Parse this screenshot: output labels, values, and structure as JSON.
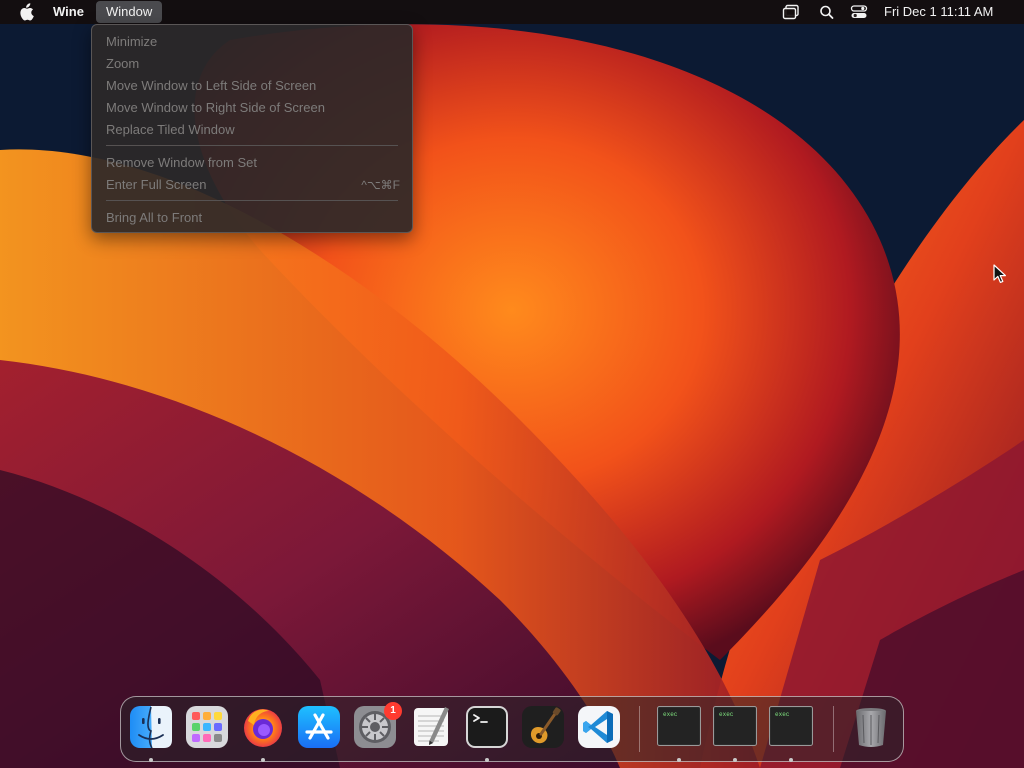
{
  "menubar": {
    "app_name": "Wine",
    "menu_window": "Window",
    "clock": "Fri Dec 1  11:11 AM",
    "status_icons": [
      "screen-mirroring-icon",
      "spotlight-search-icon",
      "control-center-icon"
    ]
  },
  "window_menu": {
    "items": [
      {
        "label": "Minimize",
        "shortcut": "",
        "enabled": false
      },
      {
        "label": "Zoom",
        "shortcut": "",
        "enabled": false
      },
      {
        "label": "Move Window to Left Side of Screen",
        "shortcut": "",
        "enabled": false
      },
      {
        "label": "Move Window to Right Side of Screen",
        "shortcut": "",
        "enabled": false
      },
      {
        "label": "Replace Tiled Window",
        "shortcut": "",
        "enabled": false
      },
      {
        "label": "Remove Window from Set",
        "shortcut": "",
        "enabled": false
      },
      {
        "label": "Enter Full Screen",
        "shortcut": "^⌥⌘F",
        "enabled": false
      },
      {
        "label": "Bring All to Front",
        "shortcut": "",
        "enabled": false
      }
    ]
  },
  "dock": {
    "apps": [
      {
        "icon": "finder-icon",
        "running": true
      },
      {
        "icon": "launchpad-icon",
        "running": false
      },
      {
        "icon": "firefox-icon",
        "running": true
      },
      {
        "icon": "app-store-icon",
        "running": false
      },
      {
        "icon": "system-settings-icon",
        "running": false,
        "badge": "1"
      },
      {
        "icon": "textedit-icon",
        "running": false
      },
      {
        "icon": "terminal-icon",
        "running": true
      },
      {
        "icon": "garageband-icon",
        "running": false
      },
      {
        "icon": "vscode-icon",
        "running": false
      }
    ],
    "windows": [
      {
        "icon": "exec-window-icon",
        "label": "exec",
        "running": true
      },
      {
        "icon": "exec-window-icon",
        "label": "exec",
        "running": true
      },
      {
        "icon": "exec-window-icon",
        "label": "exec",
        "running": true
      }
    ],
    "trash": {
      "icon": "trash-icon"
    }
  },
  "colors": {
    "menu_text_disabled": "#7d7b7a",
    "badge": "#ff3b30",
    "wallpaper_bg": "#0c1a33",
    "wallpaper_orange": "#ff6a1a"
  }
}
